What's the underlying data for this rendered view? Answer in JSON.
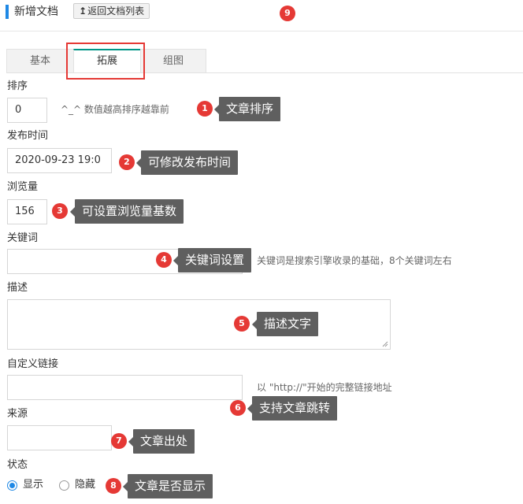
{
  "header": {
    "title": "新增文档",
    "back_label": "返回文档列表",
    "back_icon": "up-arrow-icon"
  },
  "tabs": [
    {
      "label": "基本",
      "active": false
    },
    {
      "label": "拓展",
      "active": true
    },
    {
      "label": "组图",
      "active": false
    }
  ],
  "form": {
    "sort": {
      "label": "排序",
      "value": "0",
      "hint": "^_^ 数值越高排序越靠前"
    },
    "publish_time": {
      "label": "发布时间",
      "value": "2020-09-23 19:0"
    },
    "views": {
      "label": "浏览量",
      "value": "156"
    },
    "keywords": {
      "label": "关键词",
      "value": "",
      "hint": "关键词是搜索引擎收录的基础，8个关键词左右"
    },
    "description": {
      "label": "描述",
      "value": ""
    },
    "custom_link": {
      "label": "自定义链接",
      "value": "",
      "hint": "以 \"http://\"开始的完整链接地址"
    },
    "source": {
      "label": "来源",
      "value": ""
    },
    "status": {
      "label": "状态",
      "options": [
        "显示",
        "隐藏"
      ],
      "selected": "显示"
    }
  },
  "annotations": [
    {
      "num": "1",
      "text": "文章排序"
    },
    {
      "num": "2",
      "text": "可修改发布时间"
    },
    {
      "num": "3",
      "text": "可设置浏览量基数"
    },
    {
      "num": "4",
      "text": "关键词设置"
    },
    {
      "num": "5",
      "text": "描述文字"
    },
    {
      "num": "6",
      "text": "支持文章跳转"
    },
    {
      "num": "7",
      "text": "文章出处"
    },
    {
      "num": "8",
      "text": "文章是否显示"
    },
    {
      "num": "9",
      "text": ""
    }
  ],
  "colors": {
    "accent_blue": "#1e88e5",
    "annotation_red": "#e53935",
    "callout_gray": "#5f5f5f",
    "tab_active_border": "#009688"
  }
}
